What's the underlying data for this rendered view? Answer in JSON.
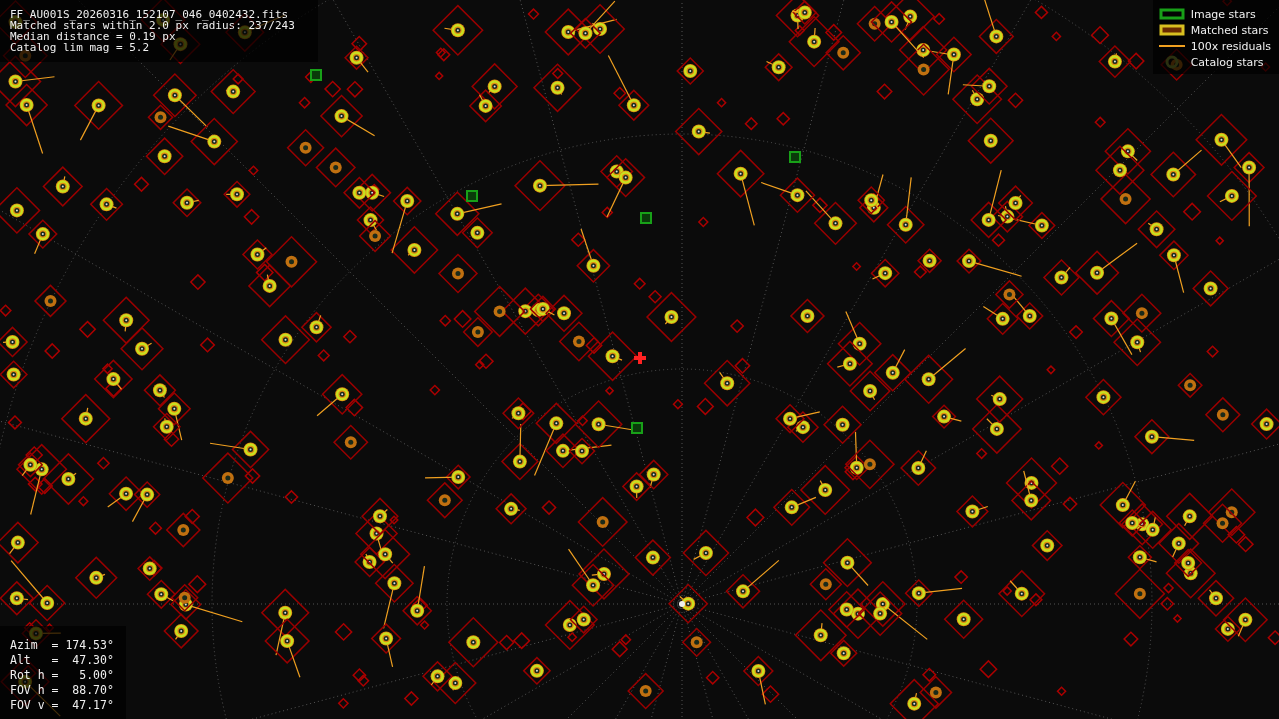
{
  "info": [
    "FF_AU001S_20260316_152107_046_0402432.fits",
    "Matched stars within 2.0 px radius: 237/243",
    "Median distance = 0.19 px",
    "Catalog lim mag = 5.2"
  ],
  "legend": [
    {
      "kind": "image",
      "label": "Image stars"
    },
    {
      "kind": "matched",
      "label": "Matched stars"
    },
    {
      "kind": "residual",
      "label": "100x residuals"
    },
    {
      "kind": "catalog",
      "label": "Catalog stars"
    }
  ],
  "pointing": [
    "Azim  = 174.53°",
    "Alt   =  47.30°",
    "Rot h =   5.00°",
    "FOV h =  88.70°",
    "FOV v =  47.17°"
  ]
}
